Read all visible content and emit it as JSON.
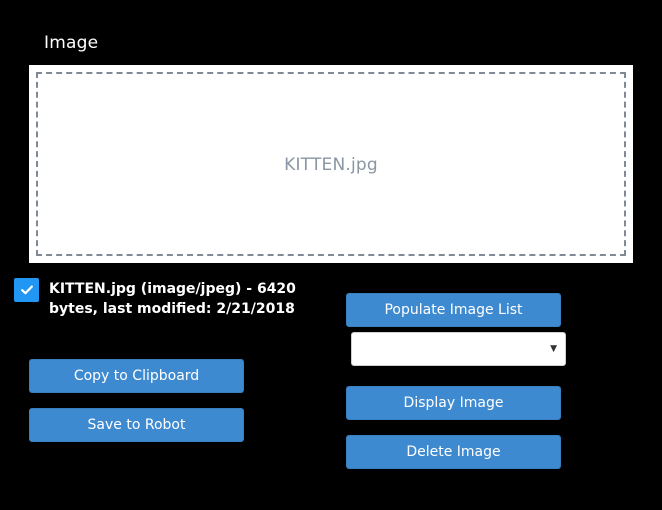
{
  "section": {
    "title": "Image"
  },
  "drop_zone": {
    "filename": "KITTEN.jpg"
  },
  "file": {
    "checked": true,
    "info": "KITTEN.jpg (image/jpeg) - 6420 bytes, last modified: 2/21/2018"
  },
  "buttons": {
    "copy_label": "Copy to Clipboard",
    "save_label": "Save to Robot",
    "populate_label": "Populate Image List",
    "display_label": "Display Image",
    "delete_label": "Delete Image"
  },
  "image_select": {
    "selected": "",
    "arrow_icon": "chevron-down-icon"
  },
  "colors": {
    "background": "#000000",
    "button": "#3e8ad1",
    "checkbox": "#2196f3",
    "drop_text": "#8a96a3"
  }
}
